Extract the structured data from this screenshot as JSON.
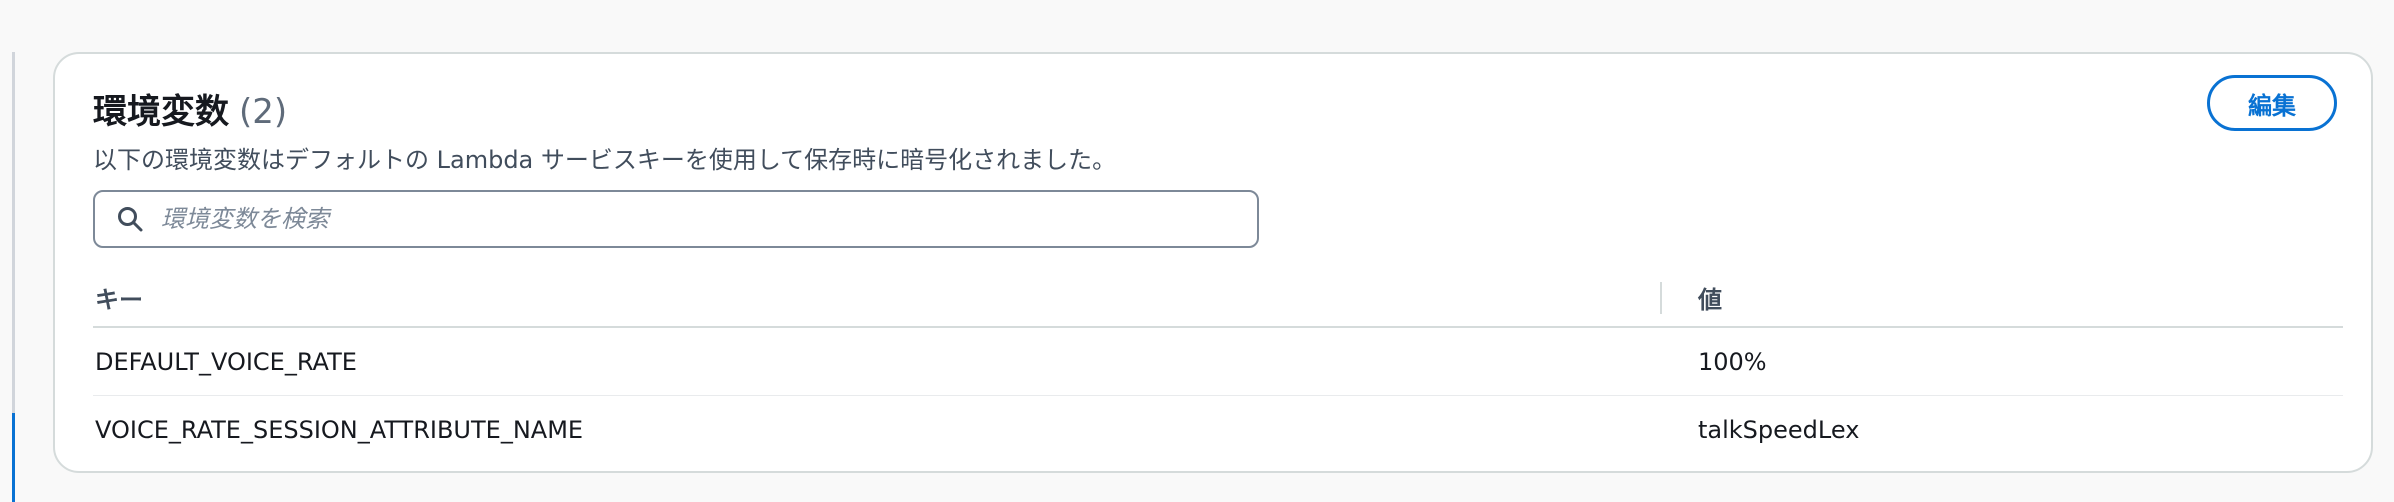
{
  "panel": {
    "title": "環境変数",
    "count": "(2)",
    "description": "以下の環境変数はデフォルトの Lambda サービスキーを使用して保存時に暗号化されました。",
    "edit_label": "編集"
  },
  "search": {
    "placeholder": "環境変数を検索",
    "value": ""
  },
  "table": {
    "headers": {
      "key": "キー",
      "value": "値"
    },
    "rows": [
      {
        "key": "DEFAULT_VOICE_RATE",
        "value": "100%"
      },
      {
        "key": "VOICE_RATE_SESSION_ATTRIBUTE_NAME",
        "value": "talkSpeedLex"
      }
    ]
  },
  "icons": {
    "search": "search-icon"
  },
  "colors": {
    "accent": "#0972d3",
    "border": "#d5dbdb",
    "text": "#16191f",
    "muted": "#5f6b7a"
  }
}
